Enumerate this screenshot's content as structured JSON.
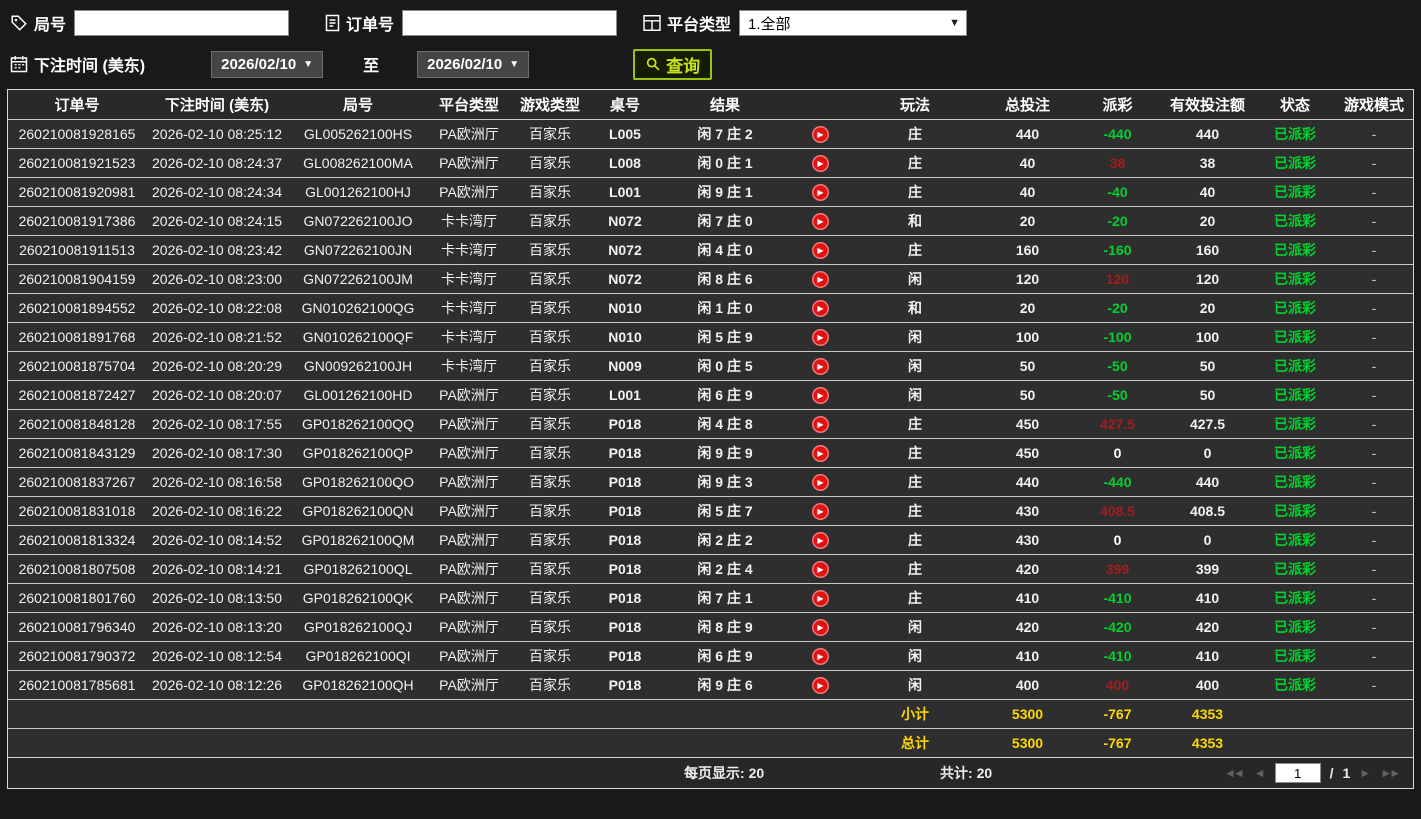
{
  "colors": {
    "accent_green": "#9cc30f",
    "accent_text": "#cbe01d",
    "payout_negative": "#00d22e",
    "payout_positive": "#a31d1d",
    "status_paid": "#00d22e",
    "totals_yellow": "#ffd800",
    "play_red": "#e01212"
  },
  "icons": {
    "dropdown_caret": "▼",
    "play": "▶",
    "first_page": "◄◄",
    "prev_page": "◄",
    "next_page": "►",
    "last_page": "►►"
  },
  "toolbar": {
    "round_label": "局号",
    "round_value": "",
    "order_label": "订单号",
    "order_value": "",
    "platform_label": "平台类型",
    "platform_value": "1.全部",
    "bet_time_label": "下注时间 (美东)",
    "date_from": "2026/02/10",
    "to_label": "至",
    "date_to": "2026/02/10",
    "search_label": "查询"
  },
  "table": {
    "headers": [
      "订单号",
      "下注时间 (美东)",
      "局号",
      "平台类型",
      "游戏类型",
      "桌号",
      "结果",
      "",
      "玩法",
      "总投注",
      "派彩",
      "有效投注额",
      "状态",
      "游戏模式"
    ],
    "rows": [
      {
        "order_id": "260210081928165",
        "bet_time": "2026-02-10 08:25:12",
        "round_id": "GL005262100HS",
        "platform": "PA欧洲厅",
        "game_type": "百家乐",
        "table_no": "L005",
        "result": "闲 7 庄 2",
        "bet_type": "庄",
        "total_bet": "440",
        "payout": "-440",
        "valid_bet": "440",
        "status": "已派彩",
        "mode": "-"
      },
      {
        "order_id": "260210081921523",
        "bet_time": "2026-02-10 08:24:37",
        "round_id": "GL008262100MA",
        "platform": "PA欧洲厅",
        "game_type": "百家乐",
        "table_no": "L008",
        "result": "闲 0 庄 1",
        "bet_type": "庄",
        "total_bet": "40",
        "payout": "38",
        "valid_bet": "38",
        "status": "已派彩",
        "mode": "-"
      },
      {
        "order_id": "260210081920981",
        "bet_time": "2026-02-10 08:24:34",
        "round_id": "GL001262100HJ",
        "platform": "PA欧洲厅",
        "game_type": "百家乐",
        "table_no": "L001",
        "result": "闲 9 庄 1",
        "bet_type": "庄",
        "total_bet": "40",
        "payout": "-40",
        "valid_bet": "40",
        "status": "已派彩",
        "mode": "-"
      },
      {
        "order_id": "260210081917386",
        "bet_time": "2026-02-10 08:24:15",
        "round_id": "GN072262100JO",
        "platform": "卡卡湾厅",
        "game_type": "百家乐",
        "table_no": "N072",
        "result": "闲 7 庄 0",
        "bet_type": "和",
        "total_bet": "20",
        "payout": "-20",
        "valid_bet": "20",
        "status": "已派彩",
        "mode": "-"
      },
      {
        "order_id": "260210081911513",
        "bet_time": "2026-02-10 08:23:42",
        "round_id": "GN072262100JN",
        "platform": "卡卡湾厅",
        "game_type": "百家乐",
        "table_no": "N072",
        "result": "闲 4 庄 0",
        "bet_type": "庄",
        "total_bet": "160",
        "payout": "-160",
        "valid_bet": "160",
        "status": "已派彩",
        "mode": "-"
      },
      {
        "order_id": "260210081904159",
        "bet_time": "2026-02-10 08:23:00",
        "round_id": "GN072262100JM",
        "platform": "卡卡湾厅",
        "game_type": "百家乐",
        "table_no": "N072",
        "result": "闲 8 庄 6",
        "bet_type": "闲",
        "total_bet": "120",
        "payout": "120",
        "valid_bet": "120",
        "status": "已派彩",
        "mode": "-"
      },
      {
        "order_id": "260210081894552",
        "bet_time": "2026-02-10 08:22:08",
        "round_id": "GN010262100QG",
        "platform": "卡卡湾厅",
        "game_type": "百家乐",
        "table_no": "N010",
        "result": "闲 1 庄 0",
        "bet_type": "和",
        "total_bet": "20",
        "payout": "-20",
        "valid_bet": "20",
        "status": "已派彩",
        "mode": "-"
      },
      {
        "order_id": "260210081891768",
        "bet_time": "2026-02-10 08:21:52",
        "round_id": "GN010262100QF",
        "platform": "卡卡湾厅",
        "game_type": "百家乐",
        "table_no": "N010",
        "result": "闲 5 庄 9",
        "bet_type": "闲",
        "total_bet": "100",
        "payout": "-100",
        "valid_bet": "100",
        "status": "已派彩",
        "mode": "-"
      },
      {
        "order_id": "260210081875704",
        "bet_time": "2026-02-10 08:20:29",
        "round_id": "GN009262100JH",
        "platform": "卡卡湾厅",
        "game_type": "百家乐",
        "table_no": "N009",
        "result": "闲 0 庄 5",
        "bet_type": "闲",
        "total_bet": "50",
        "payout": "-50",
        "valid_bet": "50",
        "status": "已派彩",
        "mode": "-"
      },
      {
        "order_id": "260210081872427",
        "bet_time": "2026-02-10 08:20:07",
        "round_id": "GL001262100HD",
        "platform": "PA欧洲厅",
        "game_type": "百家乐",
        "table_no": "L001",
        "result": "闲 6 庄 9",
        "bet_type": "闲",
        "total_bet": "50",
        "payout": "-50",
        "valid_bet": "50",
        "status": "已派彩",
        "mode": "-"
      },
      {
        "order_id": "260210081848128",
        "bet_time": "2026-02-10 08:17:55",
        "round_id": "GP018262100QQ",
        "platform": "PA欧洲厅",
        "game_type": "百家乐",
        "table_no": "P018",
        "result": "闲 4 庄 8",
        "bet_type": "庄",
        "total_bet": "450",
        "payout": "427.5",
        "valid_bet": "427.5",
        "status": "已派彩",
        "mode": "-"
      },
      {
        "order_id": "260210081843129",
        "bet_time": "2026-02-10 08:17:30",
        "round_id": "GP018262100QP",
        "platform": "PA欧洲厅",
        "game_type": "百家乐",
        "table_no": "P018",
        "result": "闲 9 庄 9",
        "bet_type": "庄",
        "total_bet": "450",
        "payout": "0",
        "valid_bet": "0",
        "status": "已派彩",
        "mode": "-"
      },
      {
        "order_id": "260210081837267",
        "bet_time": "2026-02-10 08:16:58",
        "round_id": "GP018262100QO",
        "platform": "PA欧洲厅",
        "game_type": "百家乐",
        "table_no": "P018",
        "result": "闲 9 庄 3",
        "bet_type": "庄",
        "total_bet": "440",
        "payout": "-440",
        "valid_bet": "440",
        "status": "已派彩",
        "mode": "-"
      },
      {
        "order_id": "260210081831018",
        "bet_time": "2026-02-10 08:16:22",
        "round_id": "GP018262100QN",
        "platform": "PA欧洲厅",
        "game_type": "百家乐",
        "table_no": "P018",
        "result": "闲 5 庄 7",
        "bet_type": "庄",
        "total_bet": "430",
        "payout": "408.5",
        "valid_bet": "408.5",
        "status": "已派彩",
        "mode": "-"
      },
      {
        "order_id": "260210081813324",
        "bet_time": "2026-02-10 08:14:52",
        "round_id": "GP018262100QM",
        "platform": "PA欧洲厅",
        "game_type": "百家乐",
        "table_no": "P018",
        "result": "闲 2 庄 2",
        "bet_type": "庄",
        "total_bet": "430",
        "payout": "0",
        "valid_bet": "0",
        "status": "已派彩",
        "mode": "-"
      },
      {
        "order_id": "260210081807508",
        "bet_time": "2026-02-10 08:14:21",
        "round_id": "GP018262100QL",
        "platform": "PA欧洲厅",
        "game_type": "百家乐",
        "table_no": "P018",
        "result": "闲 2 庄 4",
        "bet_type": "庄",
        "total_bet": "420",
        "payout": "399",
        "valid_bet": "399",
        "status": "已派彩",
        "mode": "-"
      },
      {
        "order_id": "260210081801760",
        "bet_time": "2026-02-10 08:13:50",
        "round_id": "GP018262100QK",
        "platform": "PA欧洲厅",
        "game_type": "百家乐",
        "table_no": "P018",
        "result": "闲 7 庄 1",
        "bet_type": "庄",
        "total_bet": "410",
        "payout": "-410",
        "valid_bet": "410",
        "status": "已派彩",
        "mode": "-"
      },
      {
        "order_id": "260210081796340",
        "bet_time": "2026-02-10 08:13:20",
        "round_id": "GP018262100QJ",
        "platform": "PA欧洲厅",
        "game_type": "百家乐",
        "table_no": "P018",
        "result": "闲 8 庄 9",
        "bet_type": "闲",
        "total_bet": "420",
        "payout": "-420",
        "valid_bet": "420",
        "status": "已派彩",
        "mode": "-"
      },
      {
        "order_id": "260210081790372",
        "bet_time": "2026-02-10 08:12:54",
        "round_id": "GP018262100QI",
        "platform": "PA欧洲厅",
        "game_type": "百家乐",
        "table_no": "P018",
        "result": "闲 6 庄 9",
        "bet_type": "闲",
        "total_bet": "410",
        "payout": "-410",
        "valid_bet": "410",
        "status": "已派彩",
        "mode": "-"
      },
      {
        "order_id": "260210081785681",
        "bet_time": "2026-02-10 08:12:26",
        "round_id": "GP018262100QH",
        "platform": "PA欧洲厅",
        "game_type": "百家乐",
        "table_no": "P018",
        "result": "闲 9 庄 6",
        "bet_type": "闲",
        "total_bet": "400",
        "payout": "400",
        "valid_bet": "400",
        "status": "已派彩",
        "mode": "-"
      }
    ],
    "subtotal": {
      "label": "小计",
      "total_bet": "5300",
      "payout": "-767",
      "valid_bet": "4353"
    },
    "grand_total": {
      "label": "总计",
      "total_bet": "5300",
      "payout": "-767",
      "valid_bet": "4353"
    }
  },
  "pagination": {
    "per_page_label": "每页显示:",
    "per_page_value": "20",
    "total_label": "共计:",
    "total_value": "20",
    "current_page": "1",
    "separator": "/",
    "total_pages": "1"
  }
}
